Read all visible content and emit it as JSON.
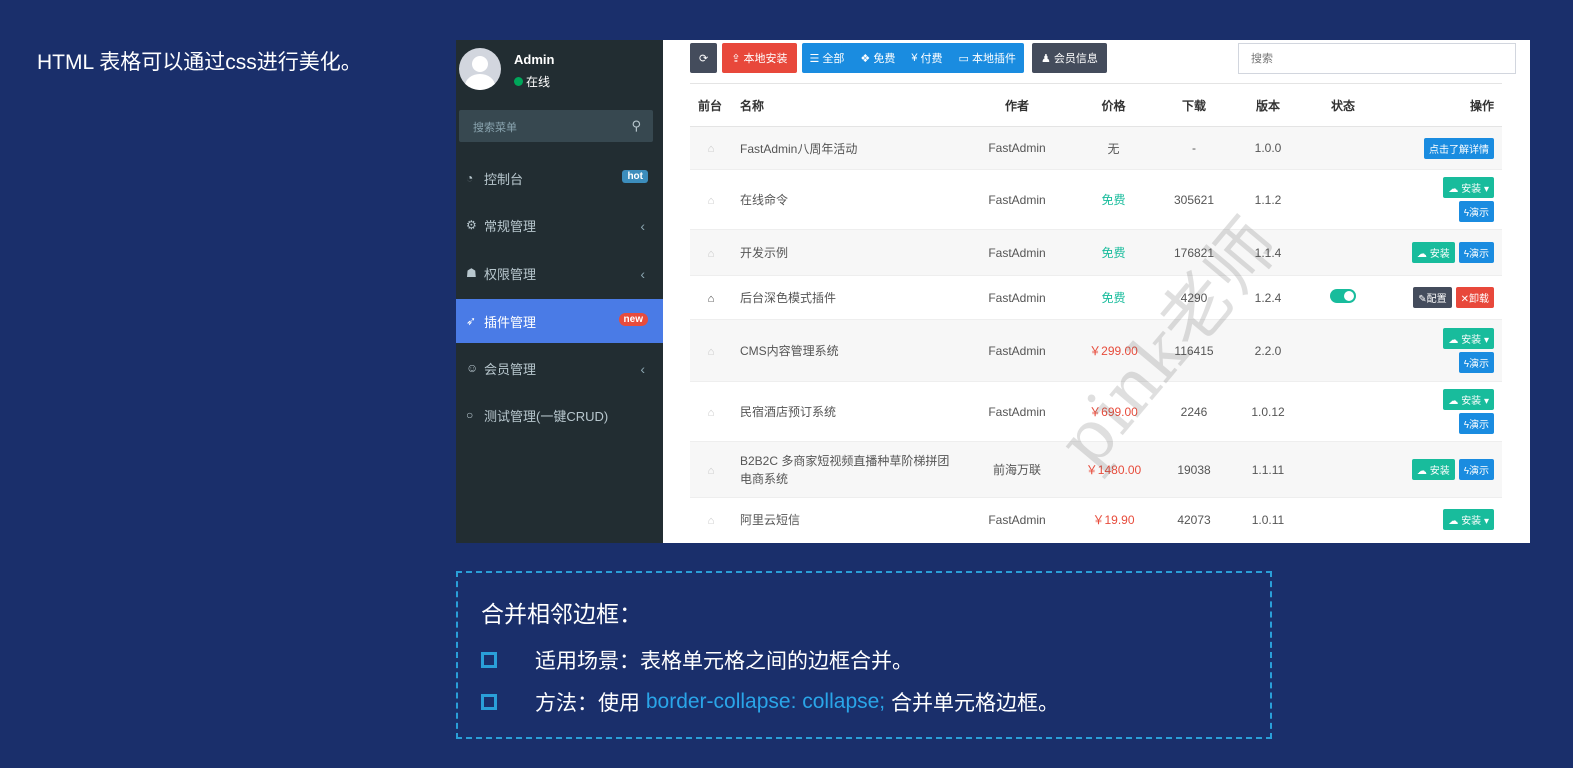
{
  "intro": "HTML 表格可以通过css进行美化。",
  "user": {
    "name": "Admin",
    "status": "在线"
  },
  "sidebar": {
    "search_placeholder": "搜索菜单",
    "items": [
      {
        "label": "控制台",
        "icon": "dashboard-icon",
        "badge": "hot"
      },
      {
        "label": "常规管理",
        "icon": "cogs-icon"
      },
      {
        "label": "权限管理",
        "icon": "users-icon"
      },
      {
        "label": "插件管理",
        "icon": "rocket-icon",
        "badge": "new",
        "active": true
      },
      {
        "label": "会员管理",
        "icon": "user-circle-icon"
      },
      {
        "label": "测试管理(一键CRUD)",
        "icon": "circle-icon"
      }
    ]
  },
  "toolbar": {
    "refresh_icon": "refresh-icon",
    "local_install": "本地安装",
    "filters": [
      "全部",
      "免费",
      "付费",
      "本地插件"
    ],
    "member_info": "会员信息",
    "search_placeholder": "搜索"
  },
  "table": {
    "headers": [
      "前台",
      "名称",
      "作者",
      "价格",
      "下载",
      "版本",
      "状态",
      "操作"
    ],
    "rows": [
      {
        "name": "FastAdmin八周年活动",
        "author": "FastAdmin",
        "price": "无",
        "downloads": "-",
        "version": "1.0.0",
        "ops": [
          "点击了解详情"
        ]
      },
      {
        "name": "在线命令",
        "author": "FastAdmin",
        "price": "免费",
        "downloads": "305621",
        "version": "1.1.2",
        "ops": [
          "安装",
          "演示"
        ]
      },
      {
        "name": "开发示例",
        "author": "FastAdmin",
        "price": "免费",
        "downloads": "176821",
        "version": "1.1.4",
        "ops": [
          "安装",
          "演示"
        ]
      },
      {
        "name": "后台深色模式插件",
        "author": "FastAdmin",
        "price": "免费",
        "downloads": "4290",
        "version": "1.2.4",
        "enabled": true,
        "ops": [
          "配置",
          "卸载"
        ]
      },
      {
        "name": "CMS内容管理系统",
        "author": "FastAdmin",
        "price": "￥299.00",
        "downloads": "116415",
        "version": "2.2.0",
        "ops": [
          "安装",
          "演示"
        ]
      },
      {
        "name": "民宿酒店预订系统",
        "author": "FastAdmin",
        "price": "￥699.00",
        "downloads": "2246",
        "version": "1.0.12",
        "ops": [
          "安装",
          "演示"
        ]
      },
      {
        "name": "B2B2C 多商家短视频直播种草阶梯拼团电商系统",
        "author": "前海万联",
        "price": "￥1480.00",
        "downloads": "19038",
        "version": "1.1.11",
        "ops": [
          "安装",
          "演示"
        ]
      },
      {
        "name": "阿里云短信",
        "author": "FastAdmin",
        "price": "￥19.90",
        "downloads": "42073",
        "version": "1.0.11",
        "ops": [
          "安装"
        ]
      }
    ]
  },
  "watermark": "pink老师",
  "note": {
    "title": "合并相邻边框：",
    "b1": "适用场景：表格单元格之间的边框合并。",
    "b2_prefix": "方法：使用 ",
    "b2_code": "border-collapse: collapse;",
    "b2_suffix": " 合并单元格边框。"
  }
}
